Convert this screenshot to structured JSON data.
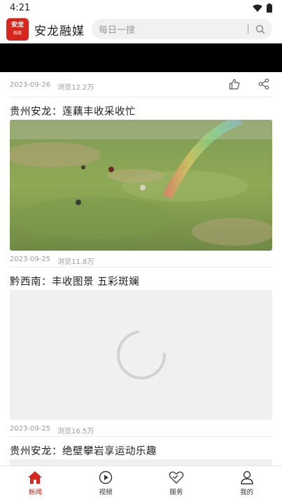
{
  "status": {
    "time": "4:21"
  },
  "header": {
    "logo_text": "安龙",
    "logo_sub": "融媒",
    "title": "安龙融媒",
    "search_placeholder": "每日一搜"
  },
  "articles": [
    {
      "date": "2023-09-26",
      "views": "浏览12.2万"
    },
    {
      "title": "贵州安龙：莲藕丰收采收忙",
      "date": "2023-09-25",
      "views": "浏览11.8万"
    },
    {
      "title": "黔西南：丰收图景 五彩斑斓",
      "date": "2023-09-25",
      "views": "浏览16.5万"
    },
    {
      "title": "贵州安龙：绝壁攀岩享运动乐趣"
    }
  ],
  "nav": [
    {
      "label": "新闻",
      "icon": "home-icon",
      "active": true
    },
    {
      "label": "视频",
      "icon": "play-icon"
    },
    {
      "label": "服务",
      "icon": "heart-icon"
    },
    {
      "label": "我的",
      "icon": "user-icon"
    }
  ],
  "colors": {
    "accent": "#d7261d",
    "meta": "#9a9a9a"
  }
}
